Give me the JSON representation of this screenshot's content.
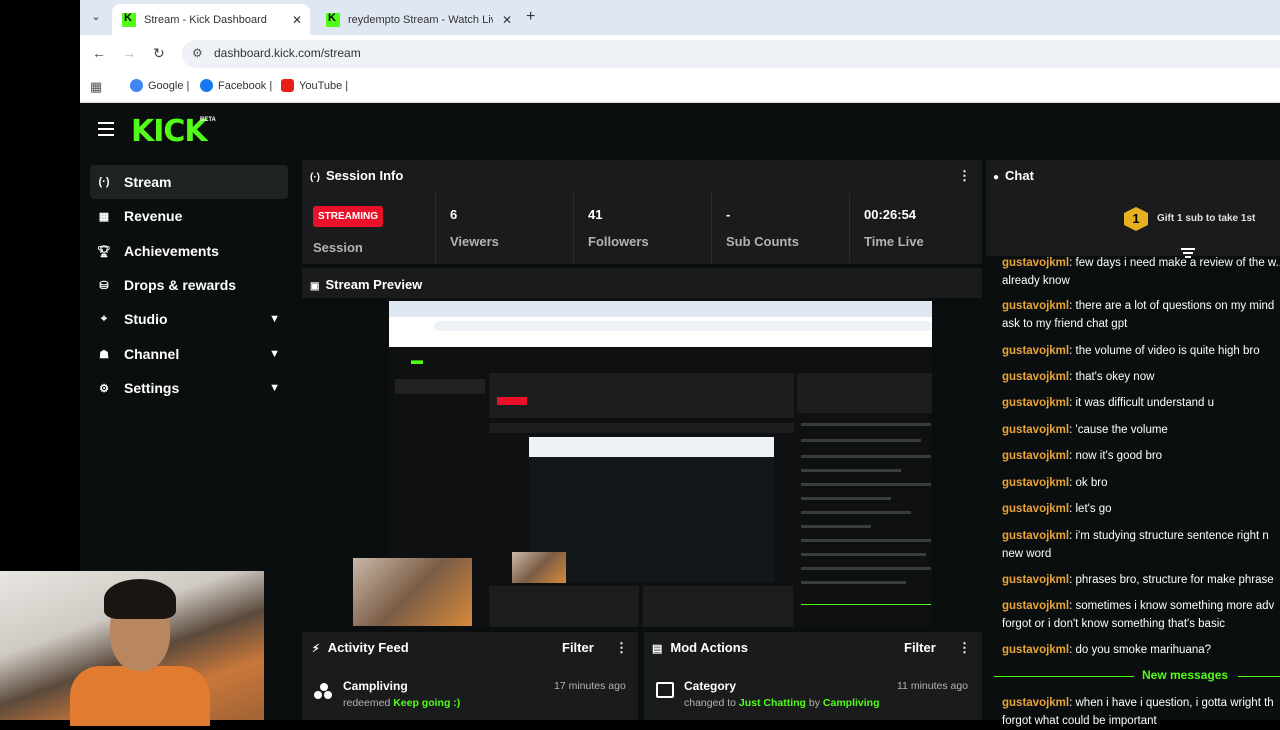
{
  "browser": {
    "tabs": [
      {
        "title": "Stream - Kick Dashboard",
        "active": true
      },
      {
        "title": "reydempto Stream - Watch Live",
        "active": false
      }
    ],
    "new_tab": "+",
    "url": "dashboard.kick.com/stream",
    "bookmarks": [
      "Google |",
      "Facebook |",
      "YouTube |"
    ]
  },
  "app": {
    "logo": "KICK",
    "beta": "BETA"
  },
  "sidebar": {
    "items": [
      {
        "label": "Stream",
        "icon": "broadcast-icon",
        "active": true
      },
      {
        "label": "Revenue",
        "icon": "chart-icon"
      },
      {
        "label": "Achievements",
        "icon": "trophy-icon"
      },
      {
        "label": "Drops & rewards",
        "icon": "drops-icon"
      },
      {
        "label": "Studio",
        "icon": "studio-icon",
        "expandable": true
      },
      {
        "label": "Channel",
        "icon": "channel-icon",
        "expandable": true
      },
      {
        "label": "Settings",
        "icon": "gear-icon",
        "expandable": true
      }
    ]
  },
  "session": {
    "title": "Session Info",
    "status_badge": "STREAMING",
    "status_label": "Session",
    "stats": [
      {
        "value": "6",
        "label": "Viewers"
      },
      {
        "value": "41",
        "label": "Followers"
      },
      {
        "value": "-",
        "label": "Sub Counts"
      },
      {
        "value": "00:26:54",
        "label": "Time Live"
      }
    ]
  },
  "preview": {
    "title": "Stream Preview"
  },
  "chat": {
    "title": "Chat",
    "gift_count": "1",
    "gift_text": "Gift 1 sub to take 1st",
    "messages": [
      {
        "user": "gustavojkml",
        "text": "few days i need make a review of the w... already know"
      },
      {
        "user": "gustavojkml",
        "text": "there are a lot of questions on my mind ask to my friend chat gpt"
      },
      {
        "user": "gustavojkml",
        "text": "the volume of video is quite high bro"
      },
      {
        "user": "gustavojkml",
        "text": "that's okey now"
      },
      {
        "user": "gustavojkml",
        "text": "it was difficult understand u"
      },
      {
        "user": "gustavojkml",
        "text": "'cause the volume"
      },
      {
        "user": "gustavojkml",
        "text": "now it's good bro"
      },
      {
        "user": "gustavojkml",
        "text": "ok bro"
      },
      {
        "user": "gustavojkml",
        "text": "let's go"
      },
      {
        "user": "gustavojkml",
        "text": "i'm studying structure sentence right n new word"
      },
      {
        "user": "gustavojkml",
        "text": "phrases bro, structure for make phrase"
      },
      {
        "user": "gustavojkml",
        "text": "sometimes i know something more adv forgot or i don't know something that's basic"
      },
      {
        "user": "gustavojkml",
        "text": "do you smoke marihuana?"
      },
      {
        "user": "gustavojkml",
        "text": "when i have i question, i gotta wright th forgot what could be important"
      }
    ],
    "new_messages": "New messages"
  },
  "activity_feed": {
    "title": "Activity Feed",
    "filter": "Filter",
    "items": [
      {
        "name": "Campliving",
        "action": "redeemed",
        "reward": "Keep going :)",
        "time": "17 minutes ago"
      }
    ]
  },
  "mod_actions": {
    "title": "Mod Actions",
    "filter": "Filter",
    "items": [
      {
        "name": "Category",
        "prefix": "changed to",
        "value": "Just Chatting",
        "by": "by",
        "actor": "Campliving",
        "time": "11 minutes ago"
      }
    ]
  },
  "colors": {
    "brand": "#53fc18",
    "live_badge": "#e9112a",
    "chat_username": "#e8a43a",
    "background": "#0b0e0f",
    "panel": "#191b1c"
  }
}
